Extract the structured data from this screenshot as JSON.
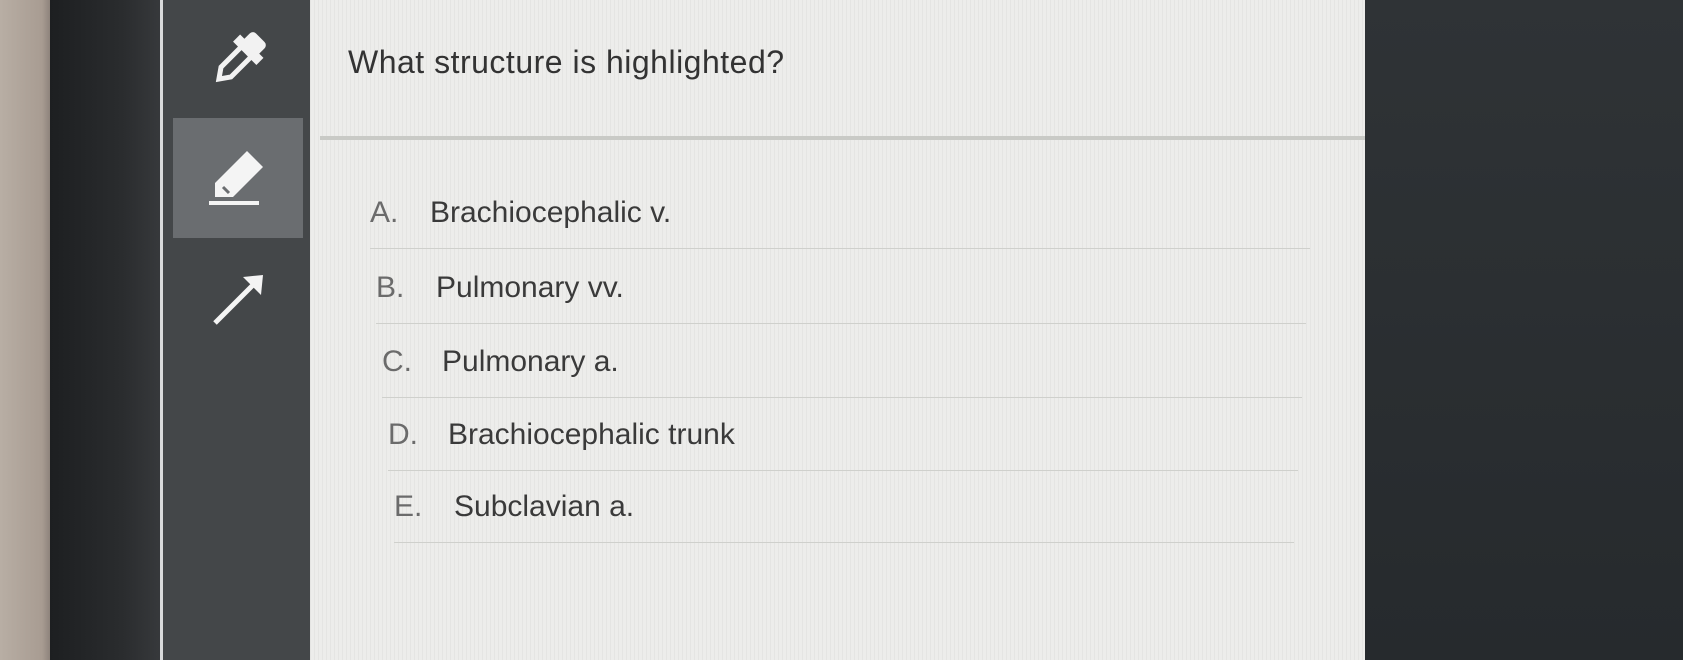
{
  "toolbar": {
    "tools": [
      {
        "name": "dropper-icon"
      },
      {
        "name": "highlighter-icon"
      },
      {
        "name": "arrow-icon"
      }
    ],
    "active_tool": "highlighter-icon"
  },
  "question": {
    "text": "What structure is highlighted?"
  },
  "options": [
    {
      "letter": "A.",
      "text": "Brachiocephalic v."
    },
    {
      "letter": "B.",
      "text": "Pulmonary vv."
    },
    {
      "letter": "C.",
      "text": "Pulmonary a."
    },
    {
      "letter": "D.",
      "text": "Brachiocephalic trunk"
    },
    {
      "letter": "E.",
      "text": "Subclavian a."
    }
  ],
  "colors": {
    "panel_bg": "#ededeb",
    "toolbar_bg": "#444749",
    "active_tool_bg": "#6a6d70"
  }
}
